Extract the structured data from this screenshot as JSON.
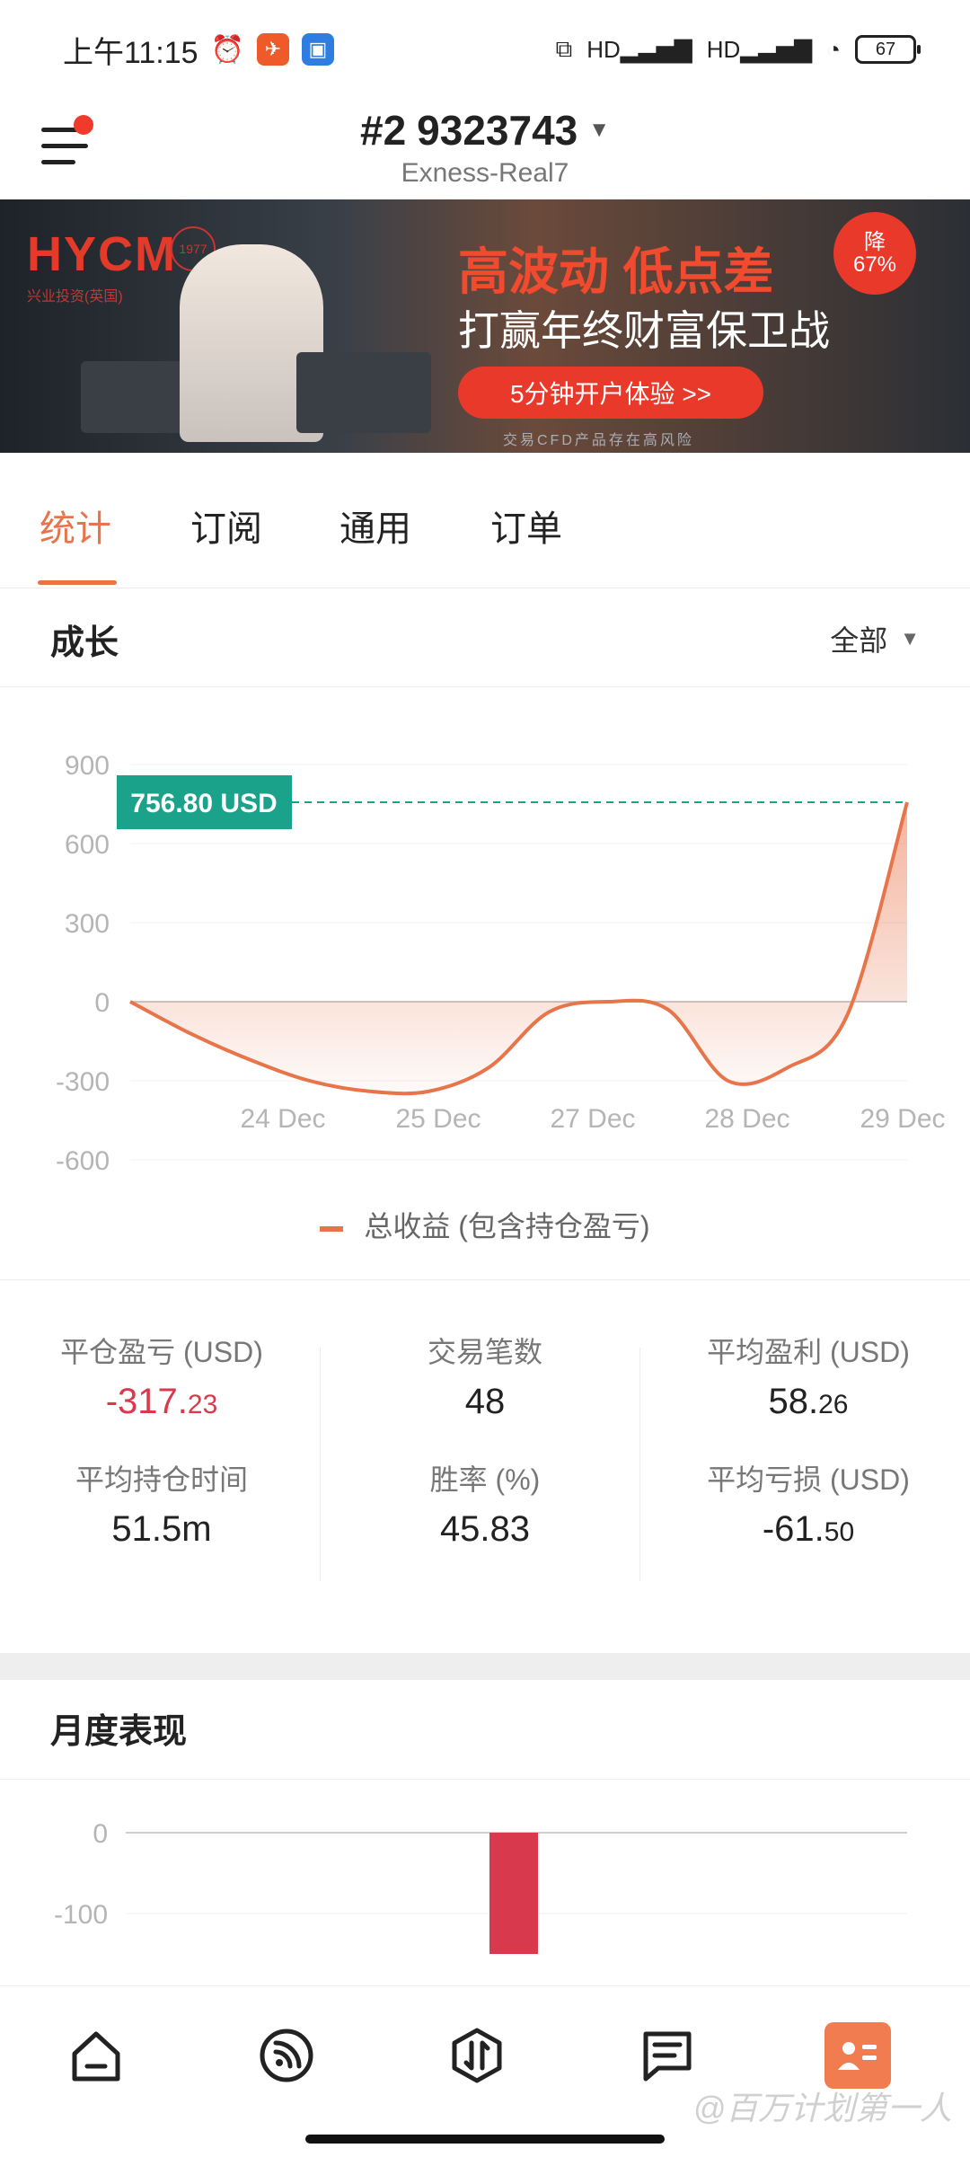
{
  "status_bar": {
    "time": "上午11:15",
    "battery": "67"
  },
  "header": {
    "account_prefix": "#2",
    "account_number": "9323743",
    "server": "Exness-Real7"
  },
  "banner": {
    "logo": "HYCM",
    "logo_sub": "兴业投资(英国)",
    "logo_year": "1977",
    "headline": "高波动 低点差",
    "subhead": "打赢年终财富保卫战",
    "cta": "5分钟开户体验 >>",
    "discount_line1": "降",
    "discount_line2": "67%",
    "risk": "交易CFD产品存在高风险"
  },
  "tabs": [
    "统计",
    "订阅",
    "通用",
    "订单"
  ],
  "growth": {
    "title": "成长",
    "filter": "全部",
    "badge": "756.80 USD",
    "legend": "总收益 (包含持仓盈亏)"
  },
  "chart_data": [
    {
      "type": "area",
      "ylim": [
        -600,
        900
      ],
      "yticks": [
        "900",
        "600",
        "300",
        "0",
        "-300",
        "-600"
      ],
      "xticks": [
        "24 Dec",
        "25 Dec",
        "27 Dec",
        "28 Dec",
        "29 Dec"
      ],
      "series": [
        {
          "name": "总收益 (包含持仓盈亏)",
          "values": [
            0,
            -120,
            -220,
            -300,
            -340,
            -340,
            -250,
            -40,
            0,
            -30,
            -300,
            -250,
            -50,
            756.8
          ]
        }
      ],
      "highlight_value": 756.8
    },
    {
      "type": "bar",
      "yticks": [
        "0",
        "-100"
      ],
      "values": [
        -150
      ]
    }
  ],
  "stats": {
    "closed_pl_label": "平仓盈亏 (USD)",
    "closed_pl_main": "-317.",
    "closed_pl_dec": "23",
    "trades_label": "交易笔数",
    "trades_value": "48",
    "avg_profit_label": "平均盈利 (USD)",
    "avg_profit_main": "58.",
    "avg_profit_dec": "26",
    "avg_hold_label": "平均持仓时间",
    "avg_hold_value": "51.5m",
    "win_rate_label": "胜率 (%)",
    "win_rate_value": "45.83",
    "avg_loss_label": "平均亏损 (USD)",
    "avg_loss_main": "-61.",
    "avg_loss_dec": "50"
  },
  "monthly": {
    "title": "月度表现"
  },
  "watermark": "@百万计划第一人",
  "colors": {
    "accent": "#e8744a",
    "negative": "#d9394c",
    "badge": "#1aa38a"
  }
}
